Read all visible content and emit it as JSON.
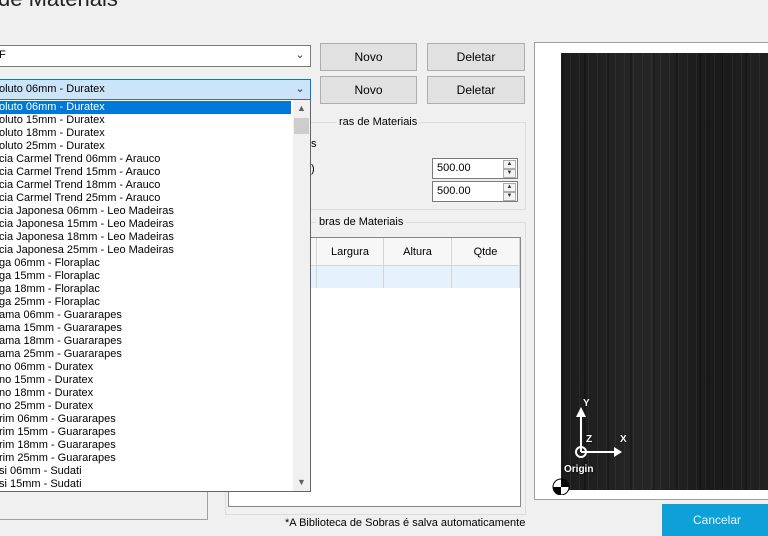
{
  "window": {
    "title": "de Materiais"
  },
  "top_combo": {
    "value": "F"
  },
  "material_combo": {
    "value": "oluto 06mm - Duratex"
  },
  "buttons": {
    "novo_1": "Novo",
    "deletar_1": "Deletar",
    "novo_2": "Novo",
    "deletar_2": "Deletar",
    "cancelar": "Cancelar"
  },
  "group_dims": {
    "label": "ras de Materiais",
    "line1": "s",
    "line2": ")",
    "value1": "500.00",
    "value2": "500.00"
  },
  "group_sobras": {
    "label": "bras de Materiais",
    "columns": [
      "Largura",
      "Altura",
      "Qtde"
    ]
  },
  "footer_note": "*A Biblioteca de Sobras é salva automaticamente",
  "dropdown": {
    "selected_index": 0,
    "items": [
      "oluto 06mm - Duratex",
      "oluto 15mm - Duratex",
      "oluto 18mm - Duratex",
      "oluto 25mm - Duratex",
      "cia Carmel Trend 06mm - Arauco",
      "cia Carmel Trend 15mm - Arauco",
      "cia Carmel Trend 18mm - Arauco",
      "cia Carmel Trend 25mm - Arauco",
      "cia Japonesa 06mm - Leo Madeiras",
      "cia Japonesa 15mm - Leo Madeiras",
      "cia Japonesa 18mm - Leo Madeiras",
      "cia Japonesa 25mm - Leo Madeiras",
      "ga 06mm - Floraplac",
      "ga 15mm - Floraplac",
      "ga 18mm - Floraplac",
      "ga 25mm - Floraplac",
      "ama 06mm - Guararapes",
      "ama 15mm - Guararapes",
      "ama 18mm - Guararapes",
      "ama 25mm - Guararapes",
      "no 06mm - Duratex",
      "no 15mm - Duratex",
      "no 18mm - Duratex",
      "no 25mm - Duratex",
      "rim 06mm - Guararapes",
      "rim 15mm - Guararapes",
      "rim 18mm - Guararapes",
      "rim 25mm - Guararapes",
      "si 06mm - Sudati",
      "si 15mm - Sudati"
    ]
  },
  "preview": {
    "axis_y": "Y",
    "axis_z": "Z",
    "axis_x": "X",
    "origin": "Origin"
  },
  "icons": {
    "combo_arrow": "chevron-down-icon",
    "spin_up": "caret-up-icon",
    "spin_down": "caret-down-icon",
    "scroll_up": "scroll-up-icon",
    "scroll_down": "scroll-down-icon"
  },
  "colors": {
    "accent": "#0078d7",
    "cancel_button": "#0ea1d9",
    "wood": "#1f1f1f"
  }
}
